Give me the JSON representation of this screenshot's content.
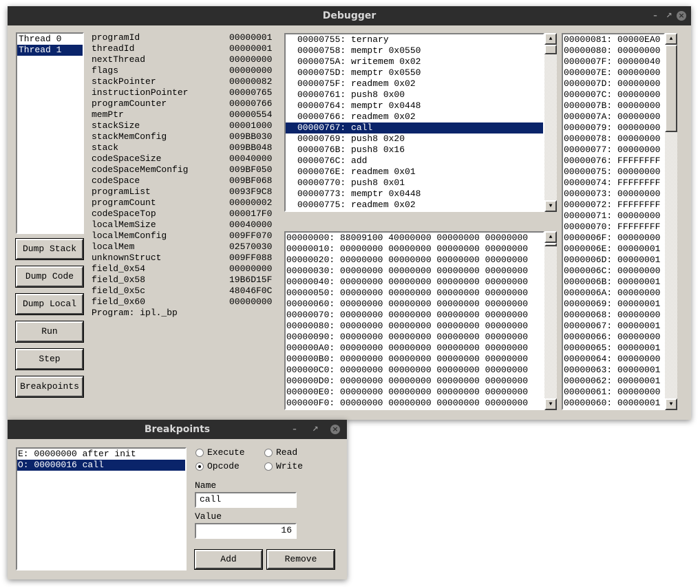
{
  "debugger": {
    "title": "Debugger",
    "threads": [
      {
        "label": "Thread 0",
        "selected": false
      },
      {
        "label": "Thread 1",
        "selected": true
      }
    ],
    "buttons": [
      "Dump Stack",
      "Dump Code",
      "Dump Local",
      "Run",
      "Step",
      "Breakpoints"
    ],
    "registers": [
      [
        "programId",
        "00000001"
      ],
      [
        "threadId",
        "00000001"
      ],
      [
        "nextThread",
        "00000000"
      ],
      [
        "flags",
        "00000000"
      ],
      [
        "stackPointer",
        "00000082"
      ],
      [
        "instructionPointer",
        "00000765"
      ],
      [
        "programCounter",
        "00000766"
      ],
      [
        "memPtr",
        "00000554"
      ],
      [
        "stackSize",
        "00001000"
      ],
      [
        "stackMemConfig",
        "009BB030"
      ],
      [
        "stack",
        "009BB048"
      ],
      [
        "codeSpaceSize",
        "00040000"
      ],
      [
        "codeSpaceMemConfig",
        "009BF050"
      ],
      [
        "codeSpace",
        "009BF068"
      ],
      [
        "programList",
        "0093F9C8"
      ],
      [
        "programCount",
        "00000002"
      ],
      [
        "codeSpaceTop",
        "000017F0"
      ],
      [
        "localMemSize",
        "00040000"
      ],
      [
        "localMemConfig",
        "009FF070"
      ],
      [
        "localMem",
        "02570030"
      ],
      [
        "unknownStruct",
        "009FF088"
      ],
      [
        "field_0x54",
        "00000000"
      ],
      [
        "field_0x58",
        "19B6D15F"
      ],
      [
        "field_0x5c",
        "48046F0C"
      ],
      [
        "field_0x60",
        "00000000"
      ]
    ],
    "program_label": "Program: ipl._bp",
    "code": [
      "00000755: ternary",
      "00000758: memptr 0x0550",
      "0000075A: writemem 0x02",
      "0000075D: memptr 0x0550",
      "0000075F: readmem 0x02",
      "00000761: push8 0x00",
      "00000764: memptr 0x0448",
      "00000766: readmem 0x02",
      "00000767: call",
      "00000769: push8 0x20",
      "0000076B: push8 0x16",
      "0000076C: add",
      "0000076E: readmem 0x01",
      "00000770: push8 0x01",
      "00000773: memptr 0x0448",
      "00000775: readmem 0x02"
    ],
    "code_selected_index": 8,
    "memory": [
      "00000000: 88009100 40000000 00000000 00000000",
      "00000010: 00000000 00000000 00000000 00000000",
      "00000020: 00000000 00000000 00000000 00000000",
      "00000030: 00000000 00000000 00000000 00000000",
      "00000040: 00000000 00000000 00000000 00000000",
      "00000050: 00000000 00000000 00000000 00000000",
      "00000060: 00000000 00000000 00000000 00000000",
      "00000070: 00000000 00000000 00000000 00000000",
      "00000080: 00000000 00000000 00000000 00000000",
      "00000090: 00000000 00000000 00000000 00000000",
      "000000A0: 00000000 00000000 00000000 00000000",
      "000000B0: 00000000 00000000 00000000 00000000",
      "000000C0: 00000000 00000000 00000000 00000000",
      "000000D0: 00000000 00000000 00000000 00000000",
      "000000E0: 00000000 00000000 00000000 00000000",
      "000000F0: 00000000 00000000 00000000 00000000"
    ],
    "stack": [
      "00000081: 00000EA0",
      "00000080: 00000000",
      "0000007F: 00000040",
      "0000007E: 00000000",
      "0000007D: 00000000",
      "0000007C: 00000000",
      "0000007B: 00000000",
      "0000007A: 00000000",
      "00000079: 00000000",
      "00000078: 00000000",
      "00000077: 00000000",
      "00000076: FFFFFFFF",
      "00000075: 00000000",
      "00000074: FFFFFFFF",
      "00000073: 00000000",
      "00000072: FFFFFFFF",
      "00000071: 00000000",
      "00000070: FFFFFFFF",
      "0000006F: 00000000",
      "0000006E: 00000001",
      "0000006D: 00000001",
      "0000006C: 00000000",
      "0000006B: 00000001",
      "0000006A: 00000000",
      "00000069: 00000001",
      "00000068: 00000000",
      "00000067: 00000001",
      "00000066: 00000000",
      "00000065: 00000001",
      "00000064: 00000000",
      "00000063: 00000001",
      "00000062: 00000001",
      "00000061: 00000000",
      "00000060: 00000001"
    ]
  },
  "breakpoints": {
    "title": "Breakpoints",
    "items": [
      {
        "label": "E: 00000000 after init",
        "selected": false
      },
      {
        "label": "O: 00000016 call",
        "selected": true
      }
    ],
    "radios": {
      "execute": "Execute",
      "read": "Read",
      "opcode": "Opcode",
      "write": "Write",
      "selected": "Opcode"
    },
    "name_label": "Name",
    "name_value": "call",
    "value_label": "Value",
    "value_value": "16",
    "add": "Add",
    "remove": "Remove"
  }
}
